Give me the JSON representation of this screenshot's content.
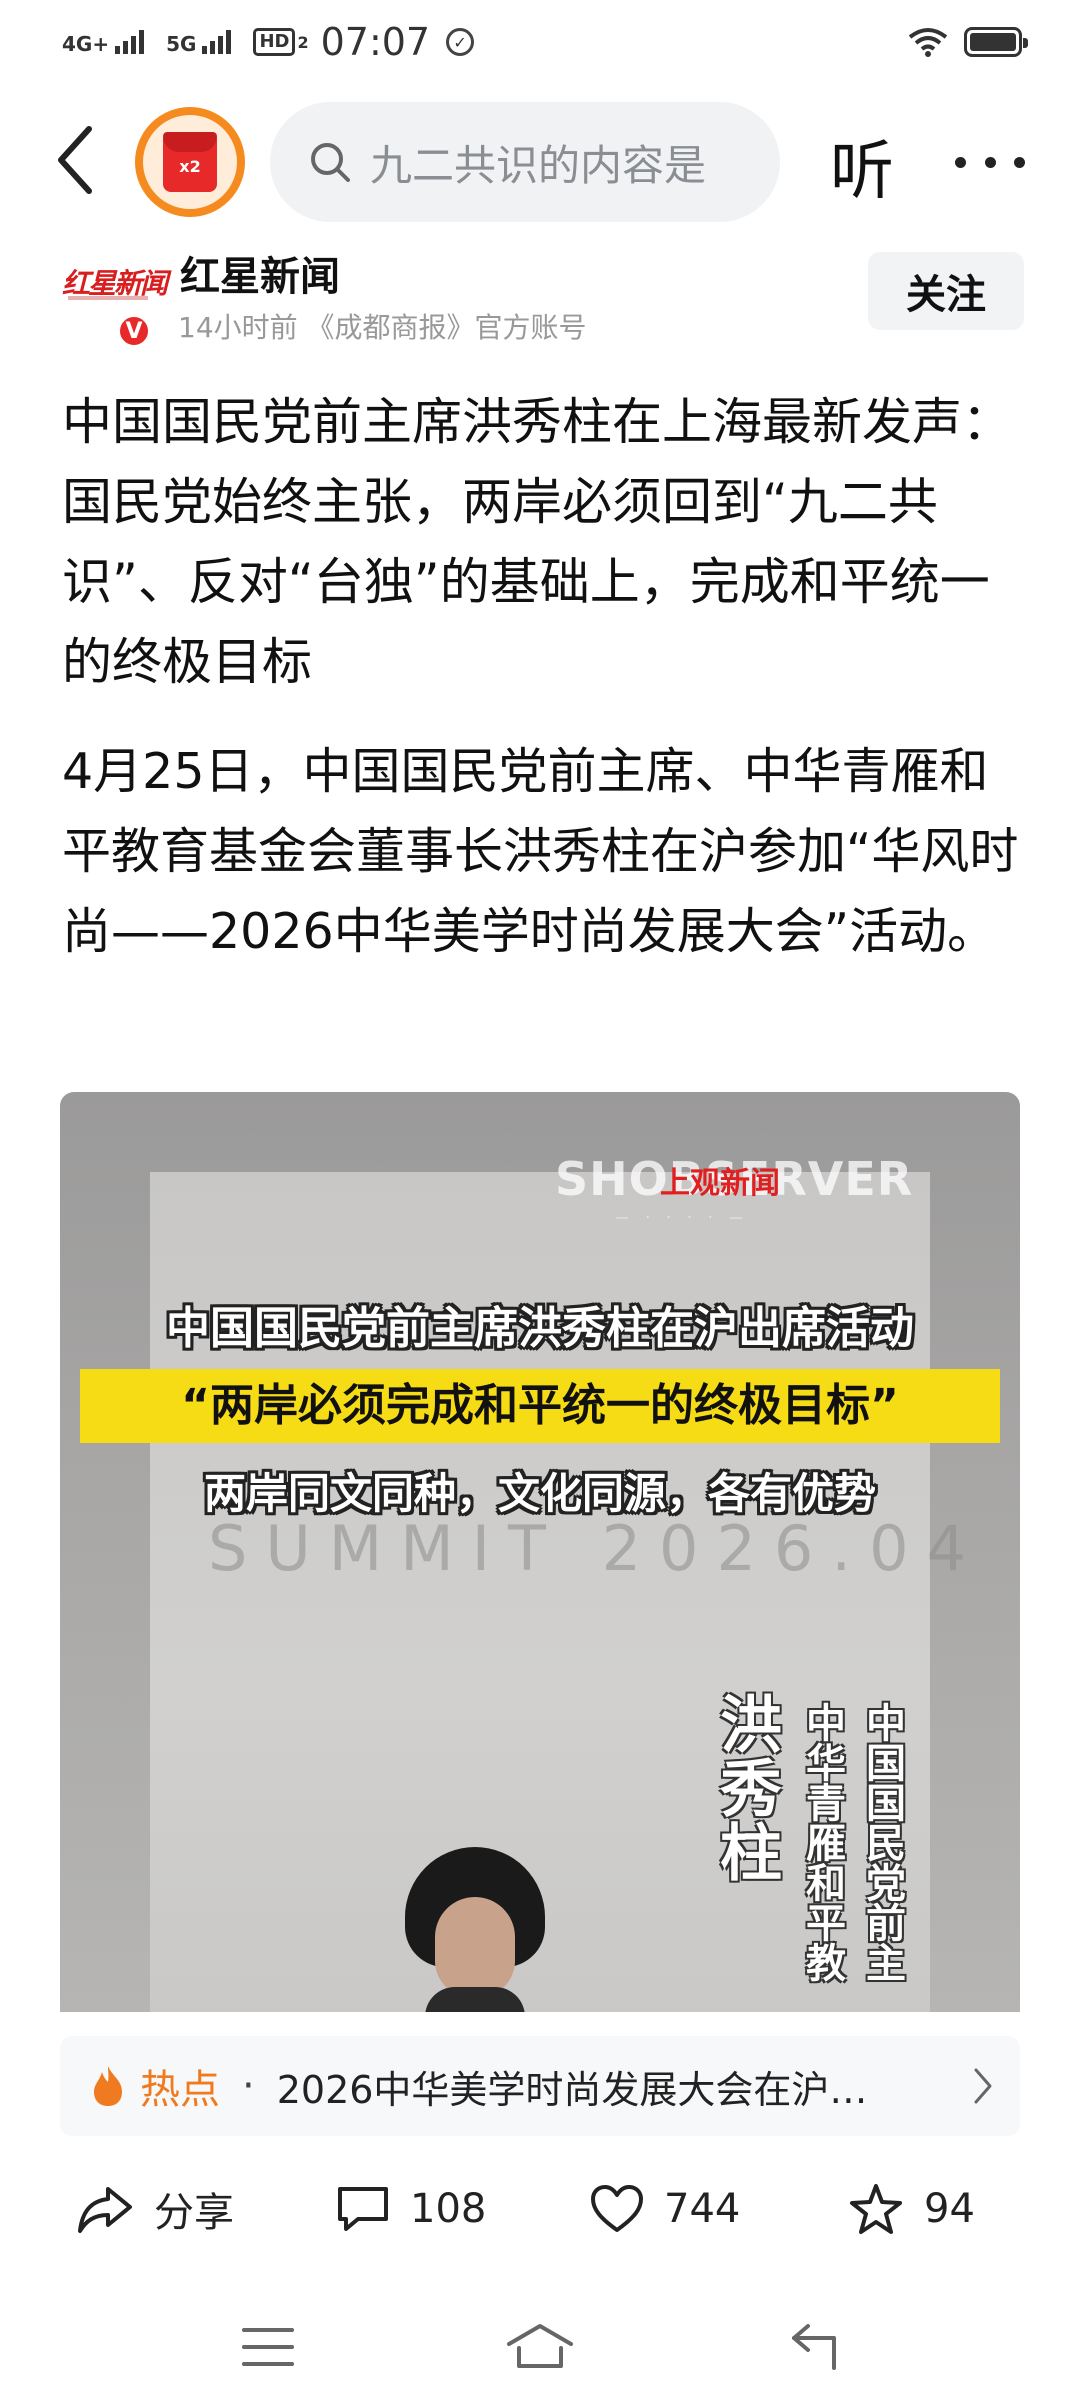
{
  "status_bar": {
    "net1": "4G+",
    "net2": "5G",
    "hd": "HD",
    "hd_sub": "2",
    "time": "07:07"
  },
  "topnav": {
    "redpack_label": "x2",
    "search_placeholder": "九二共识的内容是",
    "listen_label": "听"
  },
  "author": {
    "logo_text": "红星新闻",
    "verified_mark": "V",
    "name": "红星新闻",
    "meta": "14小时前  《成都商报》官方账号",
    "follow_label": "关注"
  },
  "article": {
    "headline": "中国国民党前主席洪秀柱在上海最新发声：国民党始终主张，两岸必须回到“九二共识”、反对“台独”的基础上，完成和平统一的终极目标",
    "body": "4月25日，中国国民党前主席、中华青雁和平教育基金会董事长洪秀柱在沪参加“华风时尚——2026中华美学时尚发展大会”活动。"
  },
  "video": {
    "watermark": "SHOBSERVER",
    "watermark_cn": "上观新闻",
    "title1": "中国国民党前主席洪秀柱在沪出席活动",
    "highlight": "“两岸必须完成和平统一的终极目标”",
    "title2": "两岸同文同种，文化同源，各有优势",
    "backdrop": "SUMMIT 2026.04",
    "name_vertical": "洪秀柱",
    "org_vertical_1": "中华青雁和平教",
    "org_vertical_2": "中国国民党前主"
  },
  "hot": {
    "label": "热点",
    "separator": "·",
    "text": "2026中华美学时尚发展大会在沪…"
  },
  "actions": {
    "share_label": "分享",
    "comments": "108",
    "likes": "744",
    "favorites": "94"
  }
}
